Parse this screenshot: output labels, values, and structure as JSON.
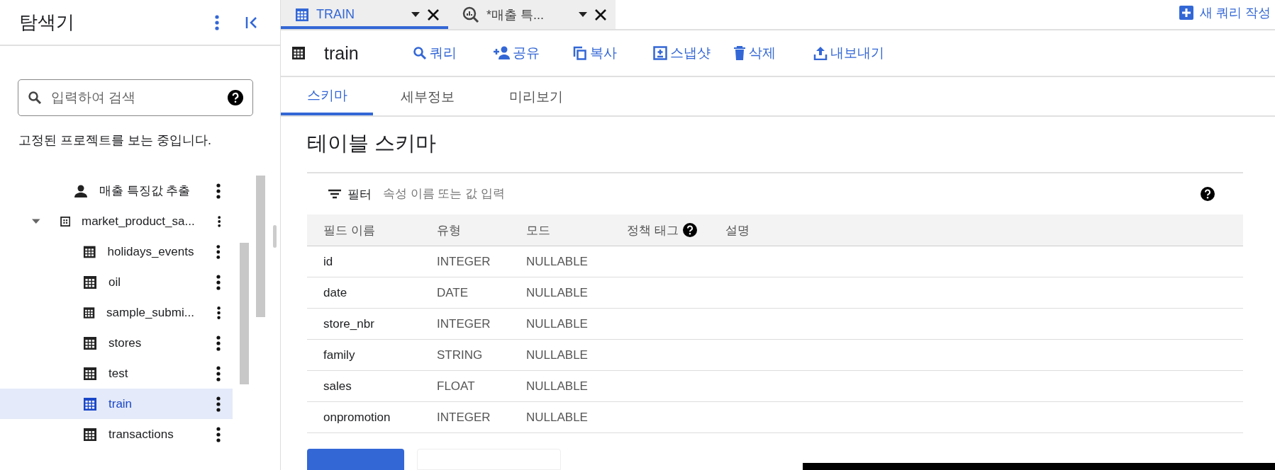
{
  "explorer": {
    "title": "탐색기",
    "search": {
      "placeholder": "입력하여 검색"
    },
    "pinned_note": "고정된 프로젝트를 보는 중입니다.",
    "tree": [
      {
        "label": "매출 특징값 추출",
        "kind": "query",
        "selected": false
      },
      {
        "label": "market_product_sa...",
        "kind": "dataset",
        "selected": false,
        "expanded": true,
        "children": [
          {
            "label": "holidays_events",
            "kind": "table",
            "selected": false
          },
          {
            "label": "oil",
            "kind": "table",
            "selected": false
          },
          {
            "label": "sample_submi...",
            "kind": "table",
            "selected": false
          },
          {
            "label": "stores",
            "kind": "table",
            "selected": false
          },
          {
            "label": "test",
            "kind": "table",
            "selected": false
          },
          {
            "label": "train",
            "kind": "table",
            "selected": true
          },
          {
            "label": "transactions",
            "kind": "table",
            "selected": false
          }
        ]
      }
    ]
  },
  "tabs": [
    {
      "label": "TRAIN",
      "kind": "table",
      "selected": true
    },
    {
      "label": "*매출 특...",
      "kind": "query",
      "selected": false
    }
  ],
  "new_query": "새 쿼리 작성",
  "resource": {
    "name": "train",
    "actions": [
      {
        "label": "쿼리",
        "kind": "search"
      },
      {
        "label": "공유",
        "kind": "share"
      },
      {
        "label": "복사",
        "kind": "copy"
      },
      {
        "label": "스냅샷",
        "kind": "snapshot"
      },
      {
        "label": "삭제",
        "kind": "delete"
      },
      {
        "label": "내보내기",
        "kind": "export"
      }
    ]
  },
  "subtabs": [
    {
      "label": "스키마",
      "selected": true
    },
    {
      "label": "세부정보",
      "selected": false
    },
    {
      "label": "미리보기",
      "selected": false
    }
  ],
  "schema": {
    "title": "테이블 스키마",
    "filter_label": "필터",
    "filter_placeholder": "속성 이름 또는 값 입력",
    "columns": [
      "필드 이름",
      "유형",
      "모드",
      "정책 태그",
      "설명"
    ],
    "rows": [
      [
        "id",
        "INTEGER",
        "NULLABLE"
      ],
      [
        "date",
        "DATE",
        "NULLABLE"
      ],
      [
        "store_nbr",
        "INTEGER",
        "NULLABLE"
      ],
      [
        "family",
        "STRING",
        "NULLABLE"
      ],
      [
        "sales",
        "FLOAT",
        "NULLABLE"
      ],
      [
        "onpromotion",
        "INTEGER",
        "NULLABLE"
      ]
    ]
  }
}
